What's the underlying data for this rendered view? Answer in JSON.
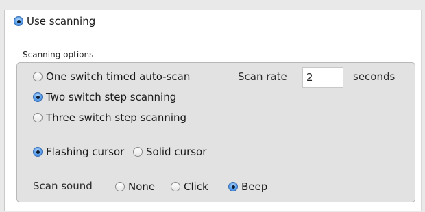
{
  "use_scanning": {
    "label": "Use scanning",
    "selected": true
  },
  "scanning_options": {
    "title": "Scanning options",
    "modes": [
      {
        "label": "One switch timed auto-scan",
        "selected": false
      },
      {
        "label": "Two switch step scanning",
        "selected": true
      },
      {
        "label": "Three switch step scanning",
        "selected": false
      }
    ],
    "scan_rate": {
      "label": "Scan rate",
      "value": "2",
      "unit": "seconds"
    },
    "cursor": [
      {
        "label": "Flashing cursor",
        "selected": true
      },
      {
        "label": "Solid cursor",
        "selected": false
      }
    ],
    "scan_sound": {
      "label": "Scan sound",
      "options": [
        {
          "label": "None",
          "selected": false
        },
        {
          "label": "Click",
          "selected": false
        },
        {
          "label": "Beep",
          "selected": true
        }
      ]
    }
  },
  "colors": {
    "radio_selected": "#2f7fdf",
    "group_background": "#e2e2e2",
    "page_background": "#ffffff"
  },
  "icons": {
    "radio_on": "radio-selected-icon",
    "radio_off": "radio-unselected-icon"
  }
}
